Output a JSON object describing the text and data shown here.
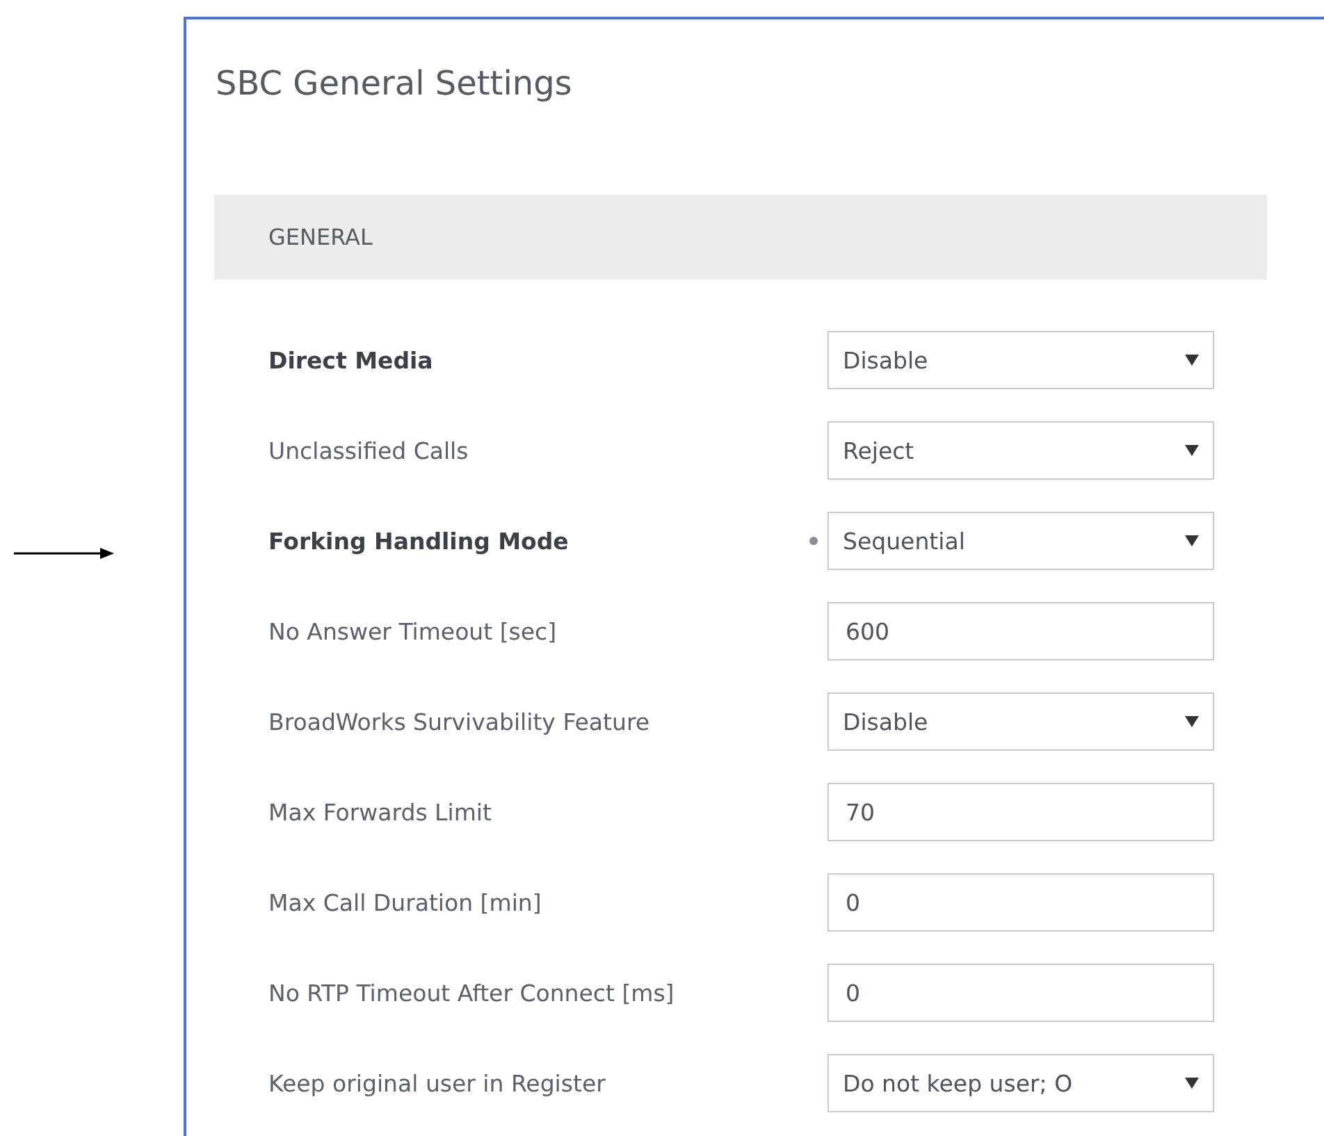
{
  "panel": {
    "title": "SBC General Settings",
    "section": "GENERAL",
    "fields": [
      {
        "label": "Direct Media",
        "modified": true,
        "marked": false,
        "kind": "select",
        "value": "Disable"
      },
      {
        "label": "Unclassified Calls",
        "modified": false,
        "marked": false,
        "kind": "select",
        "value": "Reject"
      },
      {
        "label": "Forking Handling Mode",
        "modified": true,
        "marked": true,
        "kind": "select",
        "value": "Sequential"
      },
      {
        "label": "No Answer Timeout [sec]",
        "modified": false,
        "marked": false,
        "kind": "input",
        "value": "600"
      },
      {
        "label": "BroadWorks Survivability Feature",
        "modified": false,
        "marked": false,
        "kind": "select",
        "value": "Disable"
      },
      {
        "label": "Max Forwards Limit",
        "modified": false,
        "marked": false,
        "kind": "input",
        "value": "70"
      },
      {
        "label": "Max Call Duration [min]",
        "modified": false,
        "marked": false,
        "kind": "input",
        "value": "0"
      },
      {
        "label": "No RTP Timeout After Connect [ms]",
        "modified": false,
        "marked": false,
        "kind": "input",
        "value": "0"
      },
      {
        "label": "Keep original user in Register",
        "modified": false,
        "marked": false,
        "kind": "select",
        "value": "Do not keep user; O"
      }
    ]
  }
}
